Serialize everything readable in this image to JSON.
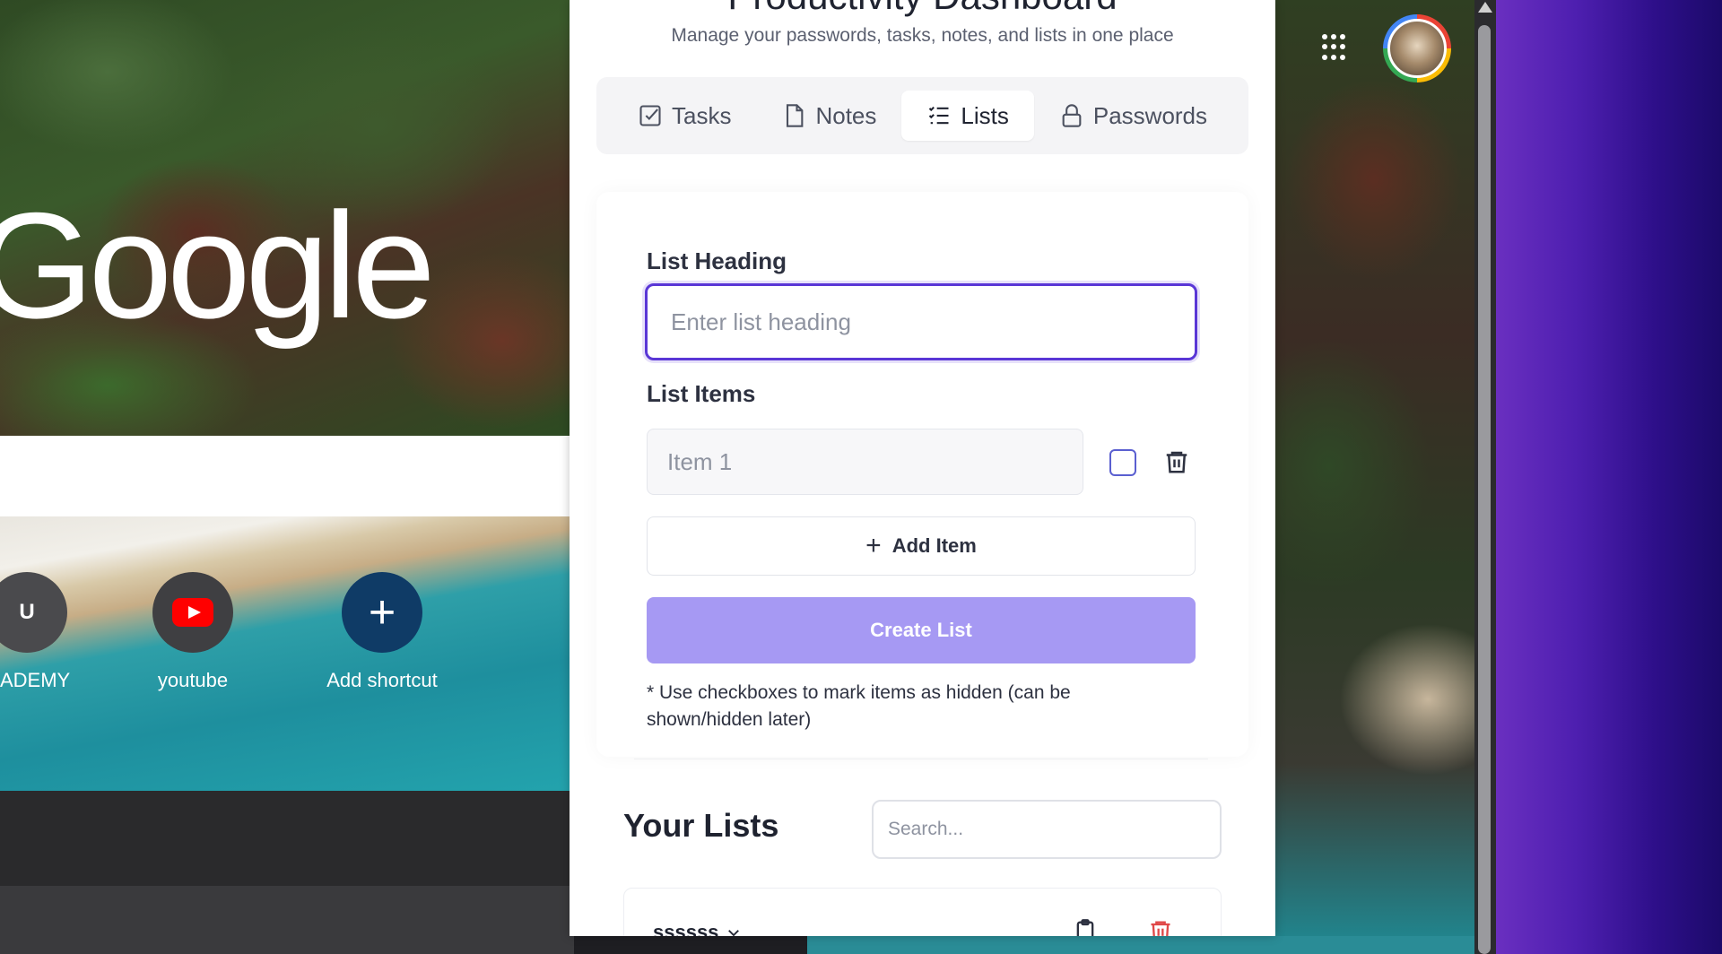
{
  "newtab": {
    "logo_text": "Google",
    "shortcuts": [
      {
        "label": "ADEMY",
        "icon_text": "U"
      },
      {
        "label": "youtube",
        "icon": "youtube-icon"
      },
      {
        "label": "Add shortcut",
        "icon_text": "+"
      }
    ]
  },
  "extension": {
    "title": "Productivity Dashboard",
    "subtitle": "Manage your passwords, tasks, notes, and lists in one place",
    "tabs": [
      {
        "label": "Tasks",
        "icon": "checkbox-icon"
      },
      {
        "label": "Notes",
        "icon": "document-icon"
      },
      {
        "label": "Lists",
        "icon": "list-icon",
        "active": true
      },
      {
        "label": "Passwords",
        "icon": "lock-icon"
      }
    ],
    "form": {
      "heading_label": "List Heading",
      "heading_placeholder": "Enter list heading",
      "heading_value": "",
      "items_label": "List Items",
      "item_placeholder": "Item 1",
      "item_value": "",
      "add_item_label": "Add Item",
      "create_label": "Create List",
      "hint": "* Use checkboxes to mark items as hidden (can be shown/hidden later)"
    },
    "your_lists": {
      "title": "Your Lists",
      "search_placeholder": "Search...",
      "items": [
        {
          "name": "ssssss"
        }
      ]
    }
  },
  "colors": {
    "accent": "#5a37d6",
    "create_button": "#a699f3",
    "delete_red": "#e04848"
  }
}
